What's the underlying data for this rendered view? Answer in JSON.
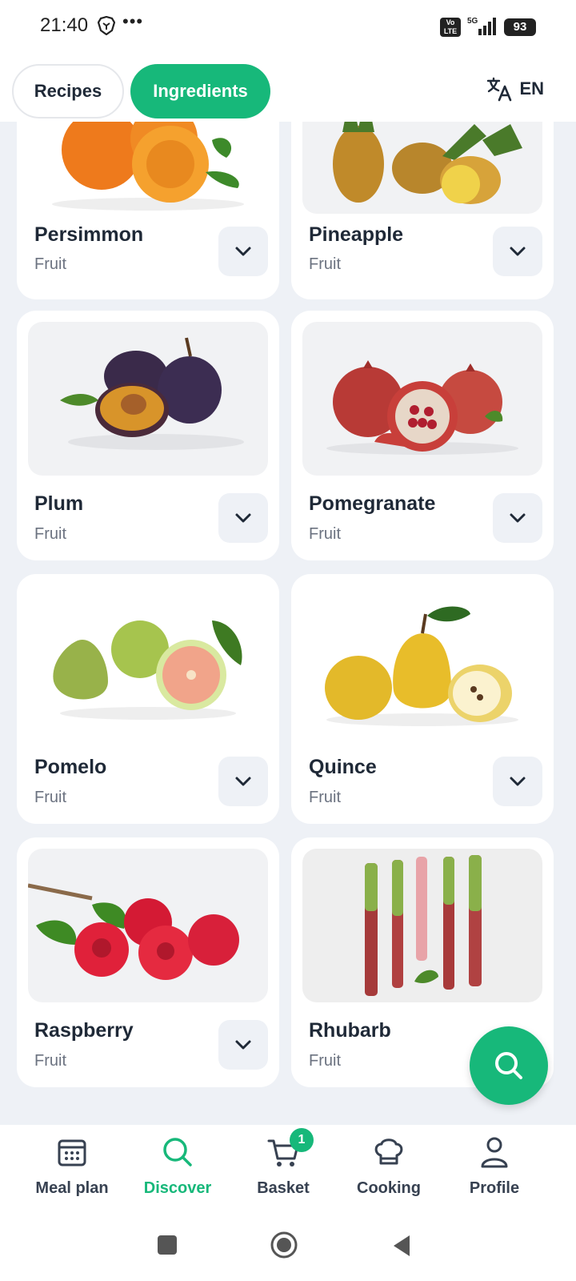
{
  "status": {
    "time": "21:40",
    "dots": "•••",
    "volte": "Vo LTE",
    "signal": "5G",
    "battery": "93"
  },
  "header": {
    "tab_recipes": "Recipes",
    "tab_ingredients": "Ingredients",
    "language": "EN"
  },
  "cards": [
    {
      "name": "Persimmon",
      "category": "Fruit"
    },
    {
      "name": "Pineapple",
      "category": "Fruit"
    },
    {
      "name": "Plum",
      "category": "Fruit"
    },
    {
      "name": "Pomegranate",
      "category": "Fruit"
    },
    {
      "name": "Pomelo",
      "category": "Fruit"
    },
    {
      "name": "Quince",
      "category": "Fruit"
    },
    {
      "name": "Raspberry",
      "category": "Fruit"
    },
    {
      "name": "Rhubarb",
      "category": "Fruit"
    }
  ],
  "nav": {
    "meal_plan": "Meal plan",
    "discover": "Discover",
    "basket": "Basket",
    "basket_badge": "1",
    "cooking": "Cooking",
    "profile": "Profile"
  },
  "colors": {
    "accent": "#17b87a",
    "background": "#eef1f6"
  }
}
